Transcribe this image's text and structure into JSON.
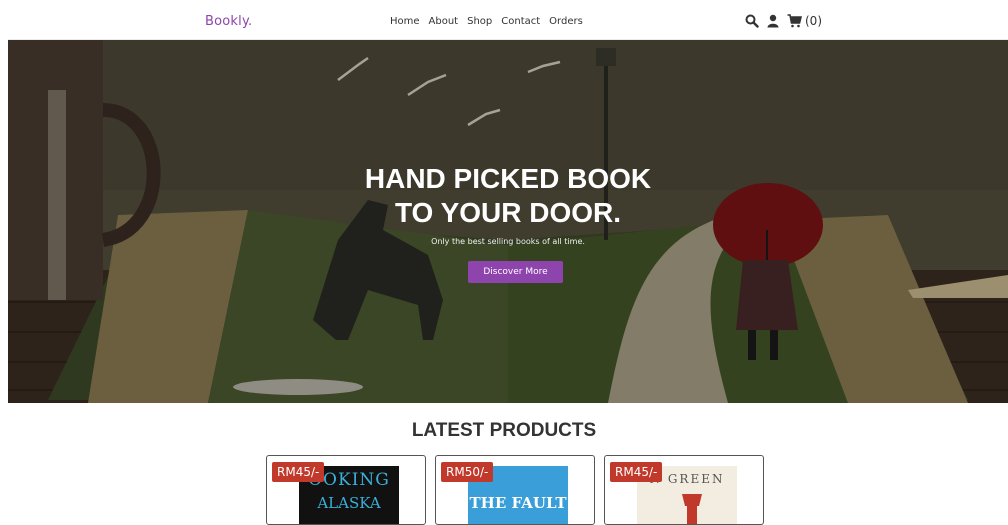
{
  "header": {
    "logo": "Bookly.",
    "nav": [
      "Home",
      "About",
      "Shop",
      "Contact",
      "Orders"
    ],
    "cart_count": "(0)"
  },
  "hero": {
    "title_line1": "HAND PICKED BOOK",
    "title_line2": "TO YOUR DOOR.",
    "subtitle": "Only the best selling books of all time.",
    "button_label": "Discover More"
  },
  "products": {
    "title": "LATEST PRODUCTS",
    "items": [
      {
        "price": "RM45/-",
        "cover_text": "OOKING",
        "cover_text2": "ALASKA",
        "cover_bg": "#111111",
        "cover_fg": "#3ab0d8"
      },
      {
        "price": "RM50/-",
        "cover_text": "THE FAULT",
        "cover_bg": "#3a9fd8",
        "cover_fg": "#ffffff"
      },
      {
        "price": "RM45/-",
        "cover_text": "N GREEN",
        "cover_bg": "#f3ece0",
        "cover_fg": "#555555"
      }
    ]
  },
  "colors": {
    "accent": "#8e44ad",
    "price_badge": "#c0392b"
  }
}
